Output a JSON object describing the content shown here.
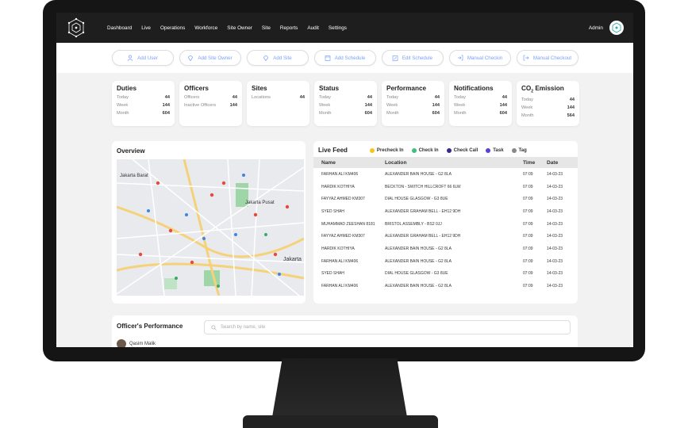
{
  "nav": {
    "items": [
      "Dashboard",
      "Live",
      "Operations",
      "Workforce",
      "Site Owner",
      "Site",
      "Reports",
      "Audit",
      "Settings"
    ],
    "user": "Admin"
  },
  "actions": [
    {
      "label": "Add User",
      "icon": "user-icon"
    },
    {
      "label": "Add Site Owner",
      "icon": "location-pin-icon"
    },
    {
      "label": "Add Site",
      "icon": "location-pin-icon"
    },
    {
      "label": "Add Schedule",
      "icon": "calendar-icon"
    },
    {
      "label": "Edit Schedule",
      "icon": "calendar-edit-icon"
    },
    {
      "label": "Manual Checkin",
      "icon": "checkin-icon"
    },
    {
      "label": "Manual Checkout",
      "icon": "checkout-icon"
    }
  ],
  "cards": {
    "duties": {
      "title": "Duties",
      "rows": [
        [
          "Today",
          "44"
        ],
        [
          "Week",
          "144"
        ],
        [
          "Month",
          "604"
        ]
      ]
    },
    "officers": {
      "title": "Officers",
      "rows": [
        [
          "Officers",
          "44"
        ],
        [
          "Inactive Officers",
          "144"
        ]
      ]
    },
    "sites": {
      "title": "Sites",
      "rows": [
        [
          "Locations",
          "44"
        ]
      ]
    },
    "status": {
      "title": "Status",
      "rows": [
        [
          "Today",
          "44"
        ],
        [
          "Week",
          "144"
        ],
        [
          "Month",
          "604"
        ]
      ]
    },
    "performance": {
      "title": "Performance",
      "rows": [
        [
          "Today",
          "44"
        ],
        [
          "Week",
          "144"
        ],
        [
          "Month",
          "604"
        ]
      ]
    },
    "notifications": {
      "title": "Notifications",
      "rows": [
        [
          "Today",
          "44"
        ],
        [
          "Week",
          "144"
        ],
        [
          "Month",
          "604"
        ]
      ]
    },
    "emission": {
      "title_main": "CO",
      "title_sub": "2",
      "title_tail": " Emission",
      "rows": [
        [
          "Today",
          "44"
        ],
        [
          "Week",
          "144"
        ],
        [
          "Month",
          "564"
        ]
      ]
    }
  },
  "overview": {
    "title": "Overview",
    "map_labels": [
      "Jakarta Barat",
      "Jakarta Pusat",
      "Jakarta"
    ]
  },
  "livefeed": {
    "title": "Live Feed",
    "legend": [
      {
        "label": "Precheck In",
        "color": "#f5c518"
      },
      {
        "label": "Check In",
        "color": "#3fbf7f"
      },
      {
        "label": "Check Call",
        "color": "#3b2a8c"
      },
      {
        "label": "Task",
        "color": "#5b3fd6"
      },
      {
        "label": "Tag",
        "color": "#888888"
      }
    ],
    "columns": [
      "Name",
      "Location",
      "Time",
      "Date"
    ],
    "rows": [
      [
        "FARHAN ALI KM406",
        "ALEXANDER BAIN HOUSE - G2 8LA",
        "07:09",
        "14-03-23"
      ],
      [
        "HARDIK KOTHIYA",
        "BECKTON - SWITCH HILLCROFT 66 6LW",
        "07:09",
        "14-03-23"
      ],
      [
        "FAYYAZ AHMED KM307",
        "DIAL HOUSE GLASGOW - G3 8UE",
        "07:09",
        "14-03-23"
      ],
      [
        "SYED SHAH",
        "ALEXANDER GRAHAM BELL - EH12 9DH",
        "07:09",
        "14-03-23"
      ],
      [
        "MUHAMMAD ZEESHAN 8181",
        "BRISTOL ASSEMBLY - BS2 0JJ",
        "07:09",
        "14-03-23"
      ],
      [
        "FAYYAZ AHMED KM307",
        "ALEXANDER GRAHAM BELL - EH12 9DH",
        "07:09",
        "14-03-23"
      ],
      [
        "HARDIK KOTHIYA",
        "ALEXANDER BAIN HOUSE - G2 8LA",
        "07:09",
        "14-03-23"
      ],
      [
        "FARHAN ALI KM406",
        "ALEXANDER BAIN HOUSE - G2 8LA",
        "07:09",
        "14-03-23"
      ],
      [
        "SYED SHAH",
        "DIAL HOUSE GLASGOW - G3 8UE",
        "07:09",
        "14-03-23"
      ],
      [
        "FARHAN ALI KM406",
        "ALEXANDER BAIN HOUSE - G2 8LA",
        "07:09",
        "14-03-23"
      ]
    ]
  },
  "performance": {
    "title": "Officer's Performance",
    "search_placeholder": "Search by name, site",
    "officer": "Qasim Malik"
  }
}
